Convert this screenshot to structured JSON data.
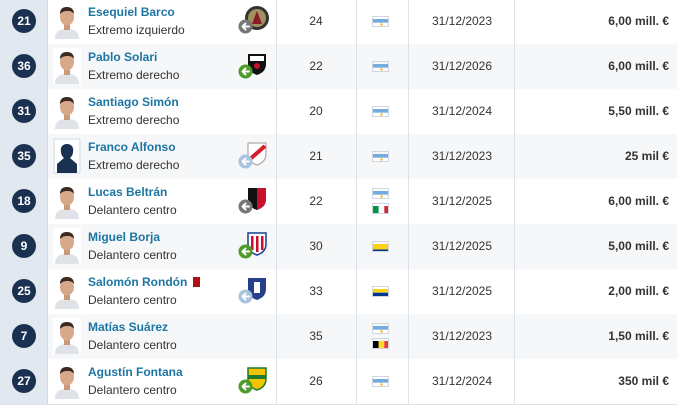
{
  "players": [
    {
      "number": "21",
      "name": "Esequiel Barco",
      "position": "Extremo izquierdo",
      "club_icon": "atlanta-united-crest",
      "loan_arrow": "out",
      "age": "24",
      "nationalities": [
        "argentina"
      ],
      "contract": "31/12/2023",
      "value": "6,00 mill. €",
      "photo": "player-photo"
    },
    {
      "number": "36",
      "name": "Pablo Solari",
      "position": "Extremo derecho",
      "club_icon": "colo-colo-crest",
      "loan_arrow": "in",
      "age": "22",
      "nationalities": [
        "argentina"
      ],
      "contract": "31/12/2026",
      "value": "6,00 mill. €",
      "photo": "player-photo"
    },
    {
      "number": "31",
      "name": "Santiago Simón",
      "position": "Extremo derecho",
      "club_icon": "",
      "loan_arrow": "",
      "age": "20",
      "nationalities": [
        "argentina"
      ],
      "contract": "31/12/2024",
      "value": "5,50 mill. €",
      "photo": "player-photo"
    },
    {
      "number": "35",
      "name": "Franco Alfonso",
      "position": "Extremo derecho",
      "club_icon": "river-plate-crest",
      "loan_arrow": "back",
      "age": "21",
      "nationalities": [
        "argentina"
      ],
      "contract": "31/12/2023",
      "value": "25 mil €",
      "photo": "silhouette"
    },
    {
      "number": "18",
      "name": "Lucas Beltrán",
      "position": "Delantero centro",
      "club_icon": "colon-crest",
      "loan_arrow": "out",
      "age": "22",
      "nationalities": [
        "argentina",
        "italy"
      ],
      "contract": "31/12/2025",
      "value": "6,00 mill. €",
      "photo": "player-photo"
    },
    {
      "number": "9",
      "name": "Miguel Borja",
      "position": "Delantero centro",
      "club_icon": "junior-crest",
      "loan_arrow": "in",
      "age": "30",
      "nationalities": [
        "colombia"
      ],
      "contract": "31/12/2025",
      "value": "5,00 mill. €",
      "photo": "player-photo"
    },
    {
      "number": "25",
      "name": "Salomón Rondón",
      "position": "Delantero centro",
      "club_icon": "everton-crest",
      "loan_arrow": "back",
      "age": "33",
      "nationalities": [
        "venezuela"
      ],
      "contract": "31/12/2025",
      "value": "2,00 mill. €",
      "photo": "player-photo",
      "red_card": true
    },
    {
      "number": "7",
      "name": "Matías Suárez",
      "position": "Delantero centro",
      "club_icon": "",
      "loan_arrow": "",
      "age": "35",
      "nationalities": [
        "argentina",
        "belgium"
      ],
      "contract": "31/12/2023",
      "value": "1,50 mill. €",
      "photo": "player-photo"
    },
    {
      "number": "27",
      "name": "Agustín Fontana",
      "position": "Delantero centro",
      "club_icon": "defensa-crest",
      "loan_arrow": "in",
      "age": "26",
      "nationalities": [
        "argentina"
      ],
      "contract": "31/12/2024",
      "value": "350 mil €",
      "photo": "player-photo"
    }
  ],
  "colors": {
    "number_badge": "#1a3151",
    "number_column": "#e1e8f0",
    "name_link": "#1d75a3",
    "arrow_in": "#4e9a2a",
    "arrow_out": "#777777",
    "arrow_back": "#a8c4e0",
    "red_card": "#b30d18"
  }
}
